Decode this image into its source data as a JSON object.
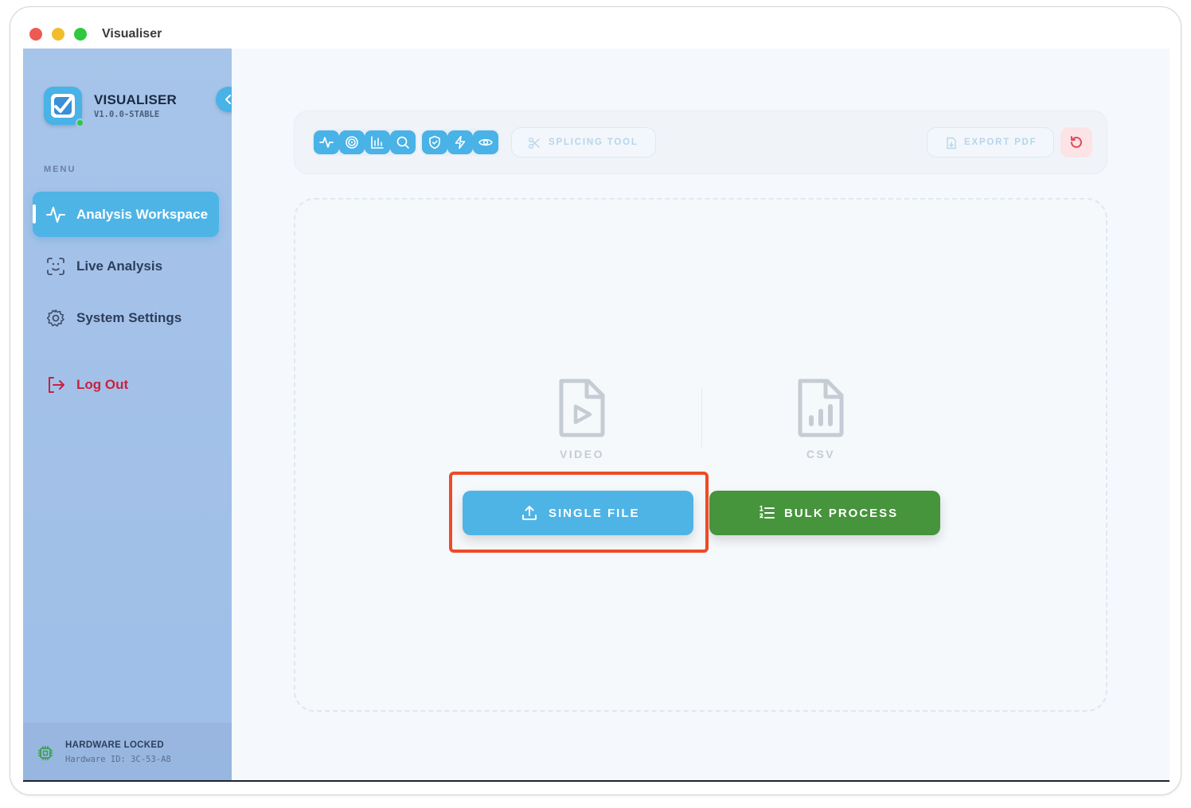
{
  "window": {
    "title": "Visualiser",
    "traffic_lights": [
      "close",
      "minimize",
      "zoom"
    ]
  },
  "sidebar": {
    "brand": "VISUALISER",
    "version": "V1.0.0-STABLE",
    "menu_heading": "MENU",
    "items": [
      {
        "label": "Analysis Workspace",
        "icon": "activity-icon",
        "active": true
      },
      {
        "label": "Live Analysis",
        "icon": "face-scan-icon",
        "active": false
      },
      {
        "label": "System Settings",
        "icon": "gear-icon",
        "active": false
      }
    ],
    "logout_label": "Log Out",
    "hardware": {
      "title": "HARDWARE LOCKED",
      "id": "Hardware ID: 3C-53-A8"
    }
  },
  "toolbar": {
    "tool_icons_group1": [
      "activity-icon",
      "target-icon",
      "bar-chart-icon",
      "search-icon"
    ],
    "tool_icons_group2": [
      "shield-icon",
      "zap-icon",
      "eye-icon"
    ],
    "splicing_label": "SPLICING TOOL",
    "export_label": "EXPORT PDF"
  },
  "dropzone": {
    "types": [
      {
        "label": "VIDEO",
        "icon": "video-file-icon"
      },
      {
        "label": "CSV",
        "icon": "chart-file-icon"
      }
    ],
    "single_label": "SINGLE FILE",
    "bulk_label": "BULK PROCESS"
  },
  "colors": {
    "accent": "#4eb4e6",
    "bulk": "#46943c",
    "logout": "#c8223e",
    "highlight": "#ee4a27"
  }
}
